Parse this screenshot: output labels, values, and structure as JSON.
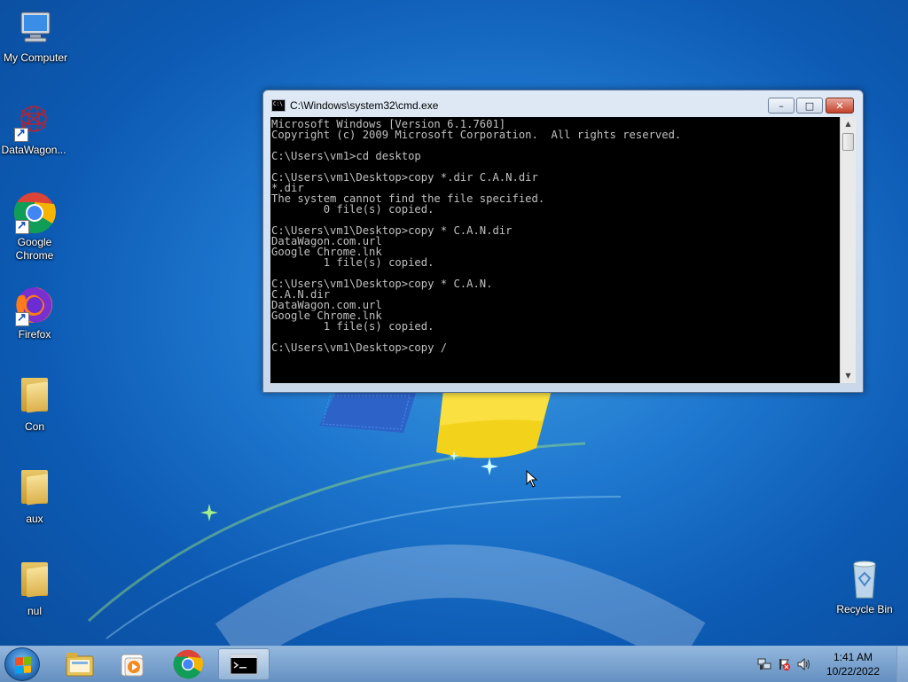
{
  "desktop": {
    "icons": [
      {
        "label": "My Computer"
      },
      {
        "label": "DataWagon..."
      },
      {
        "label": "Google Chrome"
      },
      {
        "label": "Firefox"
      },
      {
        "label": "Con"
      },
      {
        "label": "aux"
      },
      {
        "label": "nul"
      },
      {
        "label": "Recycle Bin"
      }
    ]
  },
  "cmd": {
    "title": "C:\\Windows\\system32\\cmd.exe",
    "lines": [
      "Microsoft Windows [Version 6.1.7601]",
      "Copyright (c) 2009 Microsoft Corporation.  All rights reserved.",
      "",
      "C:\\Users\\vm1>cd desktop",
      "",
      "C:\\Users\\vm1\\Desktop>copy *.dir C.A.N.dir",
      "*.dir",
      "The system cannot find the file specified.",
      "        0 file(s) copied.",
      "",
      "C:\\Users\\vm1\\Desktop>copy * C.A.N.dir",
      "DataWagon.com.url",
      "Google Chrome.lnk",
      "        1 file(s) copied.",
      "",
      "C:\\Users\\vm1\\Desktop>copy * C.A.N.",
      "C.A.N.dir",
      "DataWagon.com.url",
      "Google Chrome.lnk",
      "        1 file(s) copied.",
      "",
      "C:\\Users\\vm1\\Desktop>copy /"
    ],
    "min_glyph": "–",
    "max_glyph": "□",
    "close_glyph": "✕"
  },
  "taskbar": {
    "time": "1:41 AM",
    "date": "10/22/2022"
  },
  "colors": {
    "console_bg": "#000000",
    "console_fg": "#c0c0c0",
    "desktop_blue": "#1f78cf"
  }
}
